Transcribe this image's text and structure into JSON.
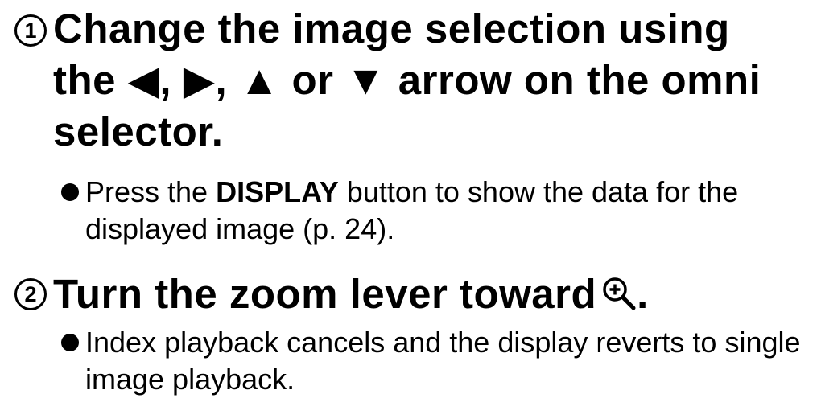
{
  "step1": {
    "number": "1",
    "text_before": "Change the image selection using the ",
    "left_arrow": "◀",
    "sep1": ", ",
    "right_arrow": "▶",
    "sep2": ", ",
    "up_arrow": "▲",
    "or_word": " or ",
    "down_arrow": "▼",
    "text_after": " arrow on the omni selector."
  },
  "bullet1": {
    "text_before": "Press the ",
    "bold_word": "DISPLAY",
    "text_after": " button to show the data for the displayed image (p. 24)."
  },
  "step2": {
    "number": "2",
    "text": "Turn the zoom lever toward",
    "icon": "zoom-in-icon",
    "period": "."
  },
  "bullet2": {
    "text": "Index playback cancels and the display reverts to single image playback."
  }
}
